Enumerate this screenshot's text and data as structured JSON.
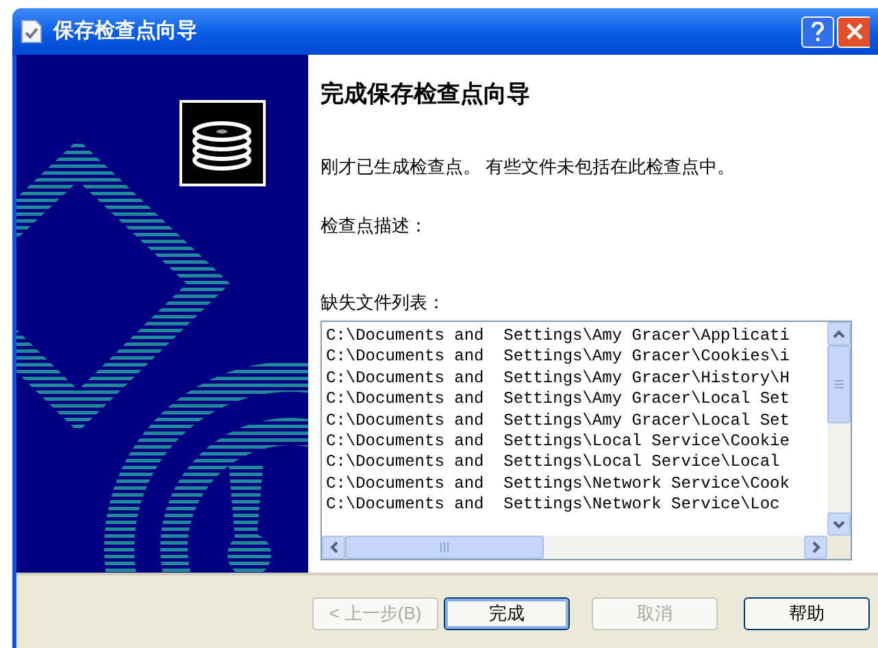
{
  "window": {
    "title": "保存检查点向导"
  },
  "heading": "完成保存检查点向导",
  "message": "刚才已生成检查点。 有些文件未包括在此检查点中。",
  "description_label": "检查点描述：",
  "missing_files": {
    "label": "缺失文件列表：",
    "items": [
      "C:\\Documents and  Settings\\Amy Gracer\\Applicati",
      "C:\\Documents and  Settings\\Amy Gracer\\Cookies\\i",
      "C:\\Documents and  Settings\\Amy Gracer\\History\\H",
      "C:\\Documents and  Settings\\Amy Gracer\\Local Set",
      "C:\\Documents and  Settings\\Amy Gracer\\Local Set",
      "C:\\Documents and  Settings\\Local Service\\Cookie",
      "C:\\Documents and  Settings\\Local Service\\Local",
      "C:\\Documents and  Settings\\Network Service\\Cook",
      "C:\\Documents and  Settings\\Network Service\\Loc"
    ]
  },
  "buttons": [
    {
      "label": "< 上一步(B)",
      "disabled": true,
      "default": false
    },
    {
      "label": "完成",
      "disabled": false,
      "default": true
    },
    {
      "label": "取消",
      "disabled": true,
      "default": false
    },
    {
      "label": "帮助",
      "disabled": false,
      "default": false
    }
  ]
}
